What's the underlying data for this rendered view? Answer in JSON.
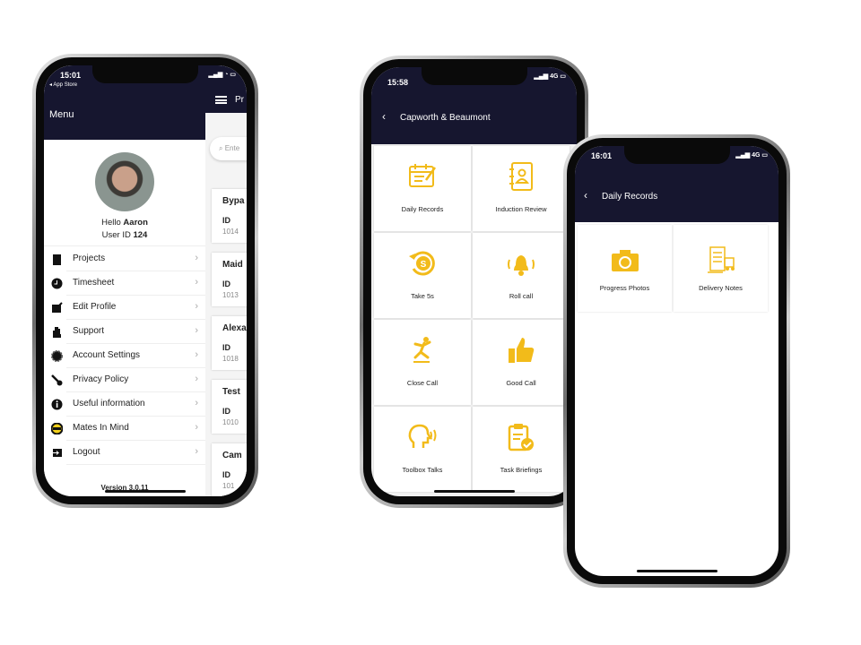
{
  "colors": {
    "navy": "#16162f",
    "accent": "#f2bb1a"
  },
  "phone1": {
    "status": {
      "time": "15:01",
      "back_app": "◂ App Store"
    },
    "menu_title": "Menu",
    "header_partial": "Pr",
    "greeting_prefix": "Hello ",
    "user_name": "Aaron",
    "user_id_prefix": "User ID ",
    "user_id": "124",
    "items": [
      {
        "label": "Projects",
        "icon": "clipboard-icon"
      },
      {
        "label": "Timesheet",
        "icon": "clock-icon"
      },
      {
        "label": "Edit Profile",
        "icon": "edit-icon"
      },
      {
        "label": "Support",
        "icon": "hand-icon"
      },
      {
        "label": "Account Settings",
        "icon": "gear-icon"
      },
      {
        "label": "Privacy Policy",
        "icon": "key-icon"
      },
      {
        "label": "Useful information",
        "icon": "info-icon"
      },
      {
        "label": "Mates In Mind",
        "icon": "mates-in-mind-icon"
      },
      {
        "label": "Logout",
        "icon": "logout-icon"
      }
    ],
    "version": "Version 3.0.11",
    "search_placeholder": "Ente",
    "projects": [
      {
        "title": "Bypa",
        "id_label": "ID",
        "id": "1014"
      },
      {
        "title": "Maid",
        "id_label": "ID",
        "id": "1013"
      },
      {
        "title": "Alexa",
        "id_label": "ID",
        "id": "1018"
      },
      {
        "title": "Test",
        "id_label": "ID",
        "id": "1010"
      },
      {
        "title": "Cam",
        "id_label": "ID",
        "id": "101"
      }
    ]
  },
  "phone2": {
    "status": {
      "time": "15:58",
      "network": "4G"
    },
    "title": "Capworth & Beaumont",
    "tiles": [
      {
        "label": "Daily Records",
        "icon": "calendar-edit-icon"
      },
      {
        "label": "Induction Review",
        "icon": "contact-book-icon"
      },
      {
        "label": "Take 5s",
        "icon": "dollar-refresh-icon"
      },
      {
        "label": "Roll call",
        "icon": "bell-icon"
      },
      {
        "label": "Close Call",
        "icon": "slip-icon"
      },
      {
        "label": "Good Call",
        "icon": "thumbs-up-icon"
      },
      {
        "label": "Toolbox Talks",
        "icon": "speaking-head-icon"
      },
      {
        "label": "Task Briefings",
        "icon": "clipboard-check-icon"
      }
    ]
  },
  "phone3": {
    "status": {
      "time": "16:01",
      "network": "4G"
    },
    "title": "Daily Records",
    "tiles": [
      {
        "label": "Progress Photos",
        "icon": "camera-icon"
      },
      {
        "label": "Delivery Notes",
        "icon": "delivery-truck-icon"
      }
    ]
  }
}
